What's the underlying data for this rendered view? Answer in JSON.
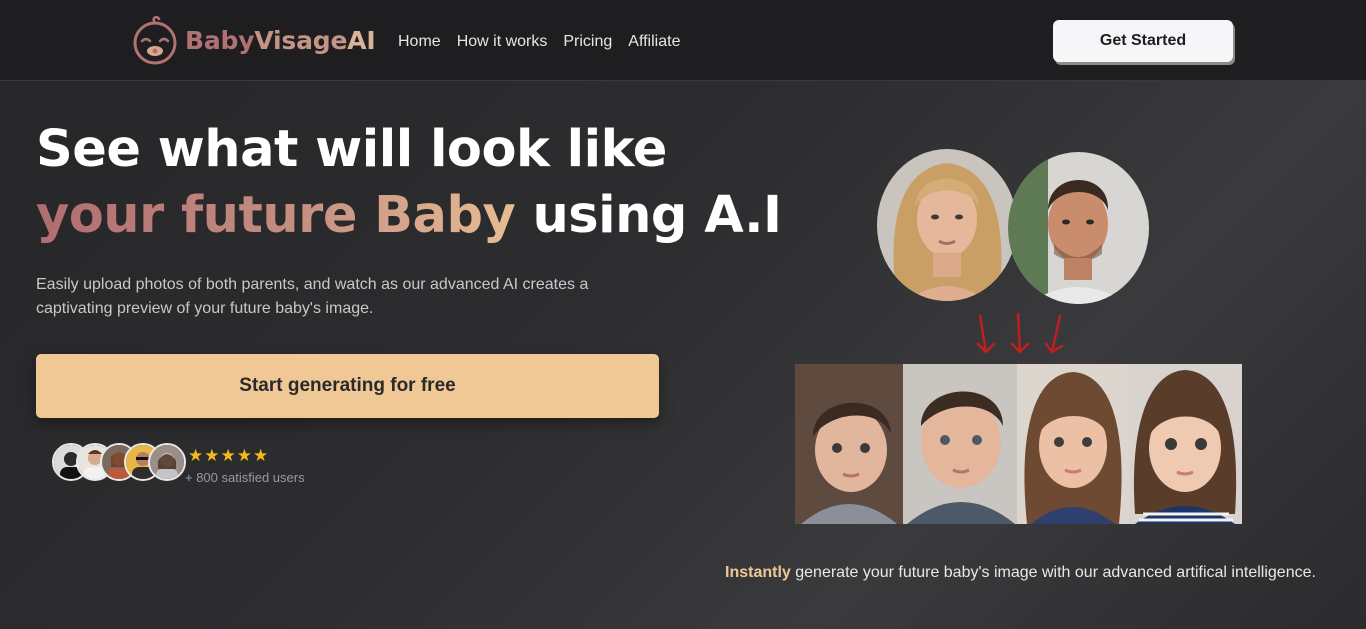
{
  "brand": {
    "name_part1": "Baby",
    "name_part2": "Visage",
    "name_part3": "AI",
    "colors": {
      "rose": "#b07272",
      "peach": "#f0c896",
      "accent": "#e6bd93"
    }
  },
  "nav": {
    "links": [
      {
        "label": "Home"
      },
      {
        "label": "How it works"
      },
      {
        "label": "Pricing"
      },
      {
        "label": "Affiliate"
      }
    ],
    "cta_label": "Get Started"
  },
  "hero": {
    "title_line1": "See what will look like",
    "title_highlight": "your future Baby",
    "title_rest": " using A.I",
    "subtitle": "Easily upload photos of both parents, and watch as our advanced AI creates a captivating preview of your future baby's image.",
    "primary_button": "Start generating for free",
    "rating_stars": "★★★★★",
    "rating": 5,
    "social_proof": "+ 800 satisfied users"
  },
  "showcase": {
    "parents": [
      "mother-photo",
      "father-photo"
    ],
    "babies": [
      "baby-boy-1-photo",
      "baby-boy-2-photo",
      "baby-girl-1-photo",
      "baby-girl-2-photo"
    ],
    "arrow_icon": "down-arrow-icon",
    "caption_highlight": "Instantly",
    "caption_rest": " generate your future baby's image with our advanced artifical intelligence."
  }
}
